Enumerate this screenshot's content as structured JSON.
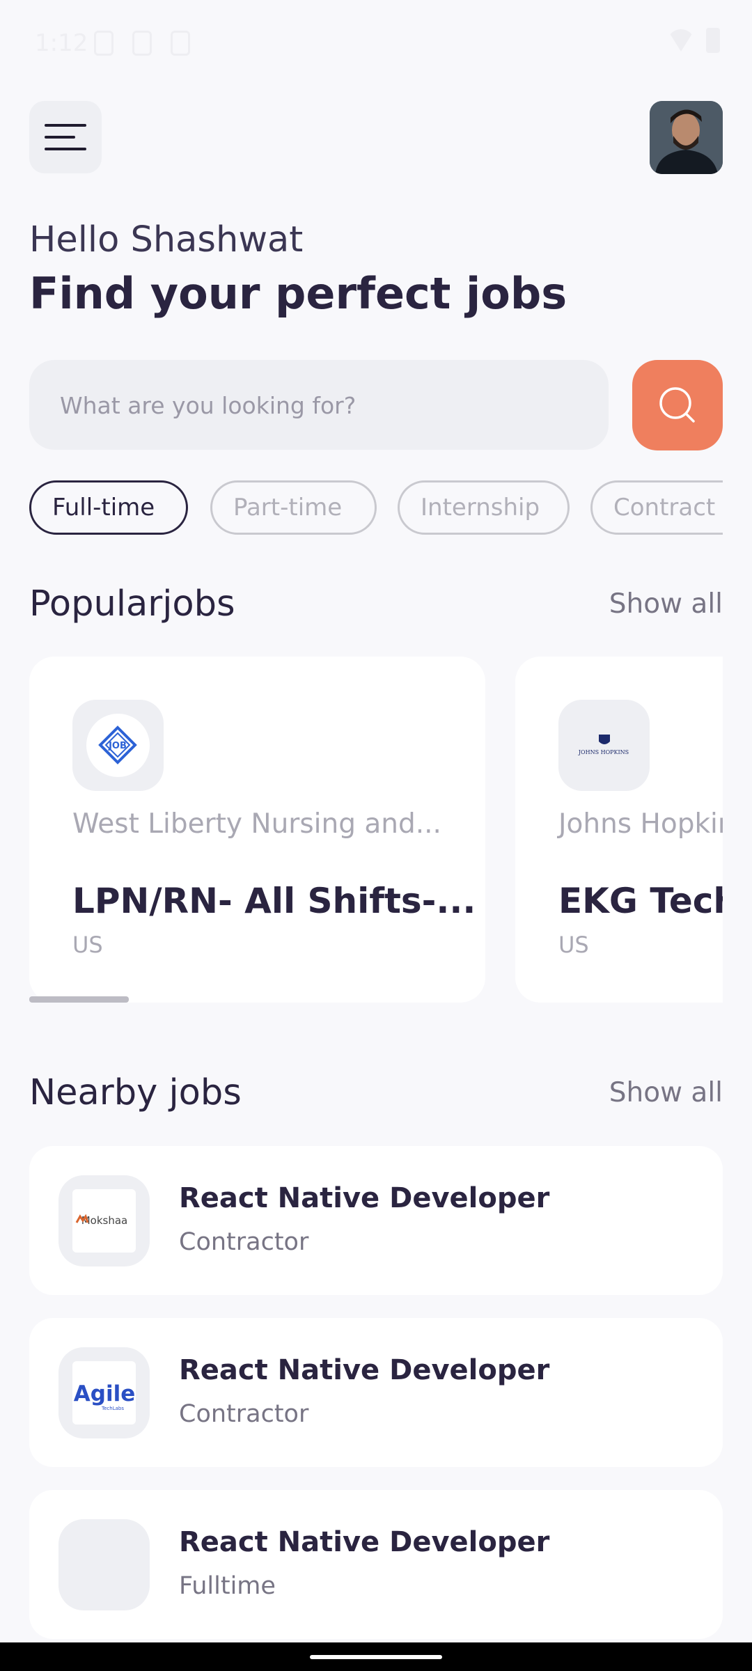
{
  "status_bar": {
    "time": "1:12"
  },
  "header": {
    "greeting": "Hello Shashwat",
    "headline": "Find your perfect jobs"
  },
  "search": {
    "placeholder": "What are you looking for?"
  },
  "filters": [
    {
      "label": "Full-time",
      "active": true
    },
    {
      "label": "Part-time",
      "active": false
    },
    {
      "label": "Internship",
      "active": false
    },
    {
      "label": "Contract",
      "active": false
    }
  ],
  "popular": {
    "title": "Popularjobs",
    "show_all": "Show all",
    "jobs": [
      {
        "company": "West Liberty Nursing and...",
        "title": "LPN/RN- All Shifts-...",
        "location": "US",
        "logo_text": "JOB"
      },
      {
        "company": "Johns Hopkins",
        "title": "EKG Technician",
        "location": "US",
        "logo_text": "JOHNS HOPKINS"
      }
    ]
  },
  "nearby": {
    "title": "Nearby jobs",
    "show_all": "Show all",
    "jobs": [
      {
        "title": "React Native Developer",
        "type": "Contractor",
        "logo_text": "Mokshaa"
      },
      {
        "title": "React Native Developer",
        "type": "Contractor",
        "logo_text": "Agile",
        "logo_sub": "TechLabs"
      },
      {
        "title": "React Native Developer",
        "type": "Fulltime"
      }
    ]
  },
  "colors": {
    "accent": "#ef7f5e",
    "primary_text": "#2a2440",
    "background": "#f8f8fb",
    "muted": "#a9a8b3"
  }
}
